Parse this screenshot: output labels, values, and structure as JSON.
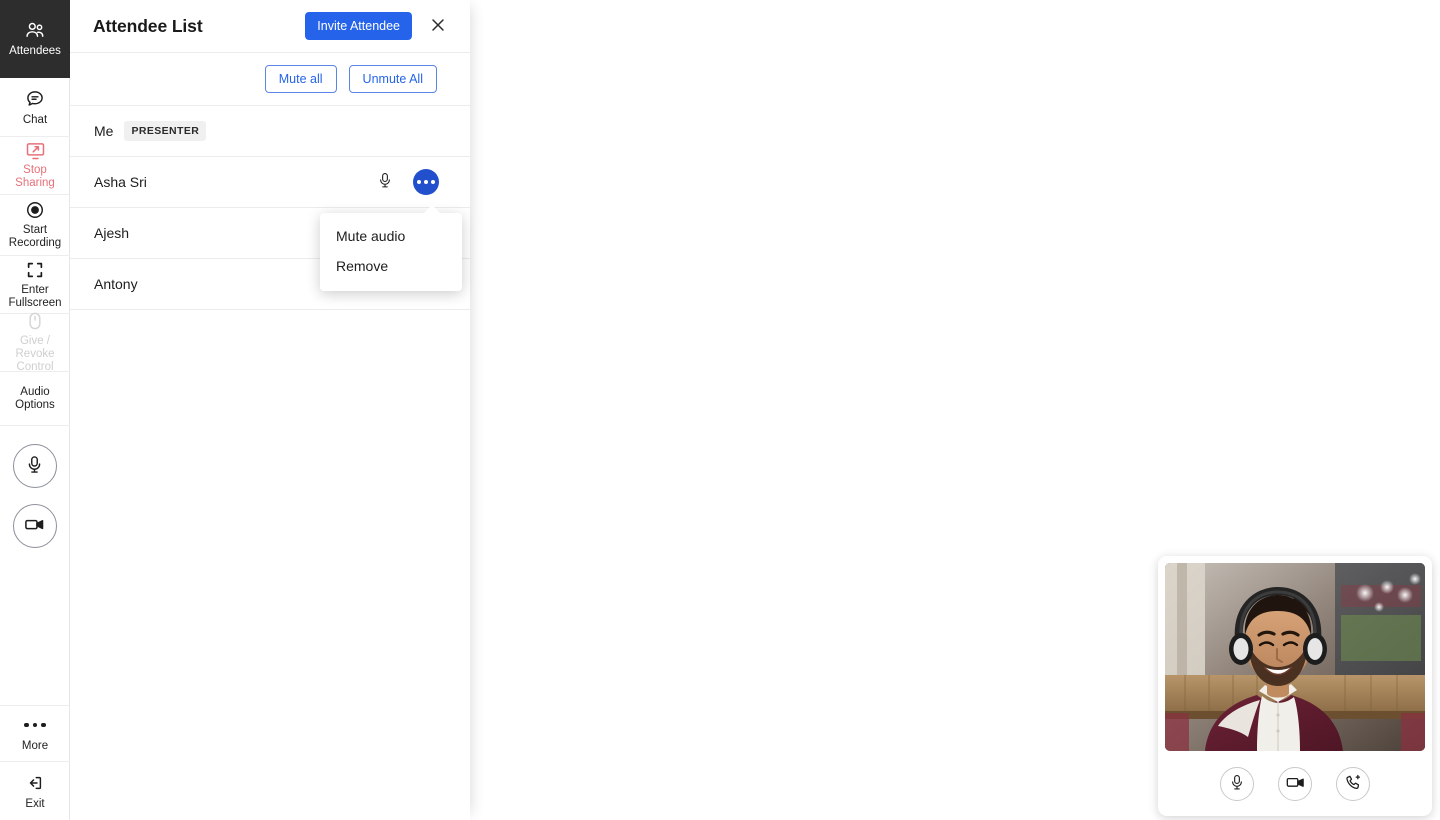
{
  "sidebar": {
    "items": [
      {
        "label": "Attendees",
        "icon": "people-icon",
        "state": "active"
      },
      {
        "label": "Chat",
        "icon": "chat-bubble-icon",
        "state": "normal"
      },
      {
        "label": "Stop Sharing",
        "icon": "screen-share-icon",
        "state": "danger"
      },
      {
        "label": "Start\nRecording",
        "icon": "record-circle-icon",
        "state": "normal"
      },
      {
        "label": "Enter\nFullscreen",
        "icon": "fullscreen-icon",
        "state": "normal"
      },
      {
        "label": "Give / Revoke\nControl",
        "icon": "mouse-icon",
        "state": "disabled"
      },
      {
        "label": "Audio\nOptions",
        "icon": "none",
        "state": "normal"
      }
    ],
    "round_buttons": [
      {
        "name": "microphone-toggle",
        "icon": "microphone-icon"
      },
      {
        "name": "camera-toggle",
        "icon": "video-camera-icon"
      }
    ],
    "bottom_items": [
      {
        "label": "More",
        "icon": "ellipsis-icon"
      },
      {
        "label": "Exit",
        "icon": "exit-icon"
      }
    ]
  },
  "panel": {
    "title": "Attendee List",
    "invite_label": "Invite Attendee",
    "close_icon": "close-icon",
    "mute_all_label": "Mute all",
    "unmute_all_label": "Unmute All",
    "attendees": [
      {
        "name": "Me",
        "badge": "PRESENTER",
        "mic": "none",
        "menu": "none"
      },
      {
        "name": "Asha Sri",
        "badge": "",
        "mic": "on",
        "menu": "open"
      },
      {
        "name": "Ajesh",
        "badge": "",
        "mic": "hidden",
        "menu": "hidden"
      },
      {
        "name": "Antony",
        "badge": "",
        "mic": "off",
        "menu": "closed"
      }
    ]
  },
  "context_menu": {
    "items": [
      {
        "label": "Mute audio"
      },
      {
        "label": "Remove"
      }
    ]
  },
  "self_video": {
    "controls": [
      {
        "name": "self-microphone-button",
        "icon": "microphone-icon"
      },
      {
        "name": "self-camera-button",
        "icon": "video-camera-icon"
      },
      {
        "name": "add-call-button",
        "icon": "phone-plus-icon"
      }
    ]
  },
  "colors": {
    "primary_blue": "#2563eb",
    "menu_blue": "#2250cc",
    "danger_red": "#e8707a",
    "active_sidebar_bg": "#2d2d2d"
  }
}
